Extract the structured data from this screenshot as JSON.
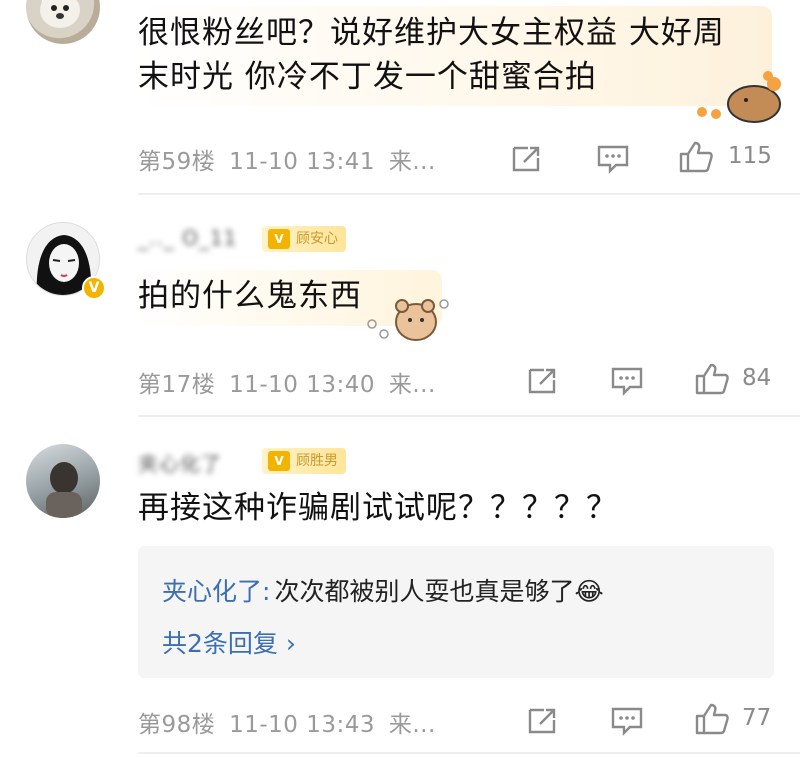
{
  "comments": [
    {
      "text_line1": "很恨粉丝吧？说好维护大女主权益 大好周",
      "text_line2": "末时光 你冷不丁发一个甜蜜合拍",
      "floor": "第59楼",
      "time": "11-10 13:41",
      "source": "来...",
      "likes": "115"
    },
    {
      "username": "_.._ O_11",
      "fan_tag": "顾安心",
      "text": "拍的什么鬼东西",
      "floor": "第17楼",
      "time": "11-10 13:40",
      "source": "来...",
      "likes": "84"
    },
    {
      "username": "夹心化了",
      "fan_tag": "顾胜男",
      "text": "再接这种诈骗剧试试呢？？？？？",
      "reply": {
        "author": "夹心化了:",
        "content": "次次都被别人耍也真是够了😂",
        "more": "共2条回复 ›"
      },
      "floor": "第98楼",
      "time": "11-10 13:43",
      "source": "来...",
      "likes": "77"
    }
  ],
  "icons": {
    "repost": "repost-icon",
    "comment": "comment-icon",
    "like": "thumbs-up-icon"
  }
}
